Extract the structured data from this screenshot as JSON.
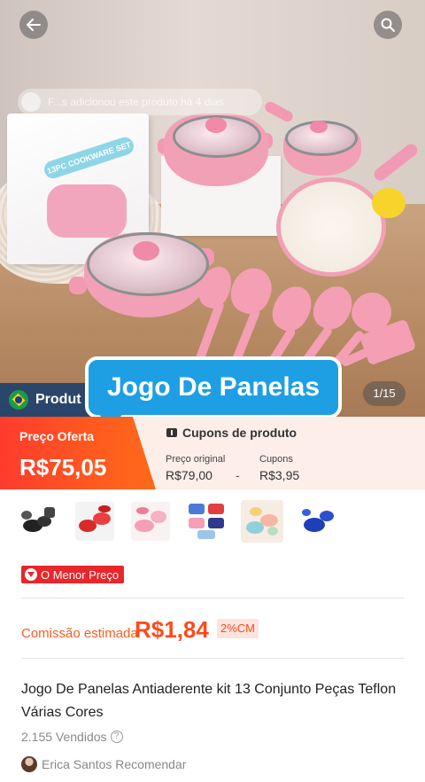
{
  "header": {
    "back_icon": "arrow-left-icon",
    "search_icon": "search-icon"
  },
  "gallery": {
    "added_notice": "F...s adicionou este produto há 4 dias",
    "counter": "1/15",
    "title_callout": "Jogo De Panelas",
    "brand_strip_label": "Produt",
    "box_label": "13PC COOKWARE SET"
  },
  "price": {
    "offer_label": "Preço Oferta",
    "offer_value": "R$75,05",
    "coupons_header": "Cupons de produto",
    "original_label": "Preço original",
    "original_value": "R$79,00",
    "minus": "-",
    "coupon_label": "Cupons",
    "coupon_value": "R$3,95"
  },
  "variants": [
    {
      "name": "black-set"
    },
    {
      "name": "red-set"
    },
    {
      "name": "pink-set"
    },
    {
      "name": "multi-color-set"
    },
    {
      "name": "pastel-set",
      "selected": true
    },
    {
      "name": "blue-set"
    }
  ],
  "badge": {
    "lowest_price": "O Menor Preço"
  },
  "commission": {
    "label": "Comissão estimada",
    "value": "R$1,84",
    "percent": "2%CM"
  },
  "product": {
    "title": "Jogo De Panelas Antiaderente kit 13 Conjunto Peças Teflon Várias Cores",
    "sold": "2.155 Vendidos",
    "recommender": "Erica Santos Recomendar"
  },
  "colors": {
    "accent_orange": "#ff5a1f",
    "badge_red": "#e8262b",
    "callout_blue": "#1e9fe3",
    "pink": "#f2a0b5"
  }
}
